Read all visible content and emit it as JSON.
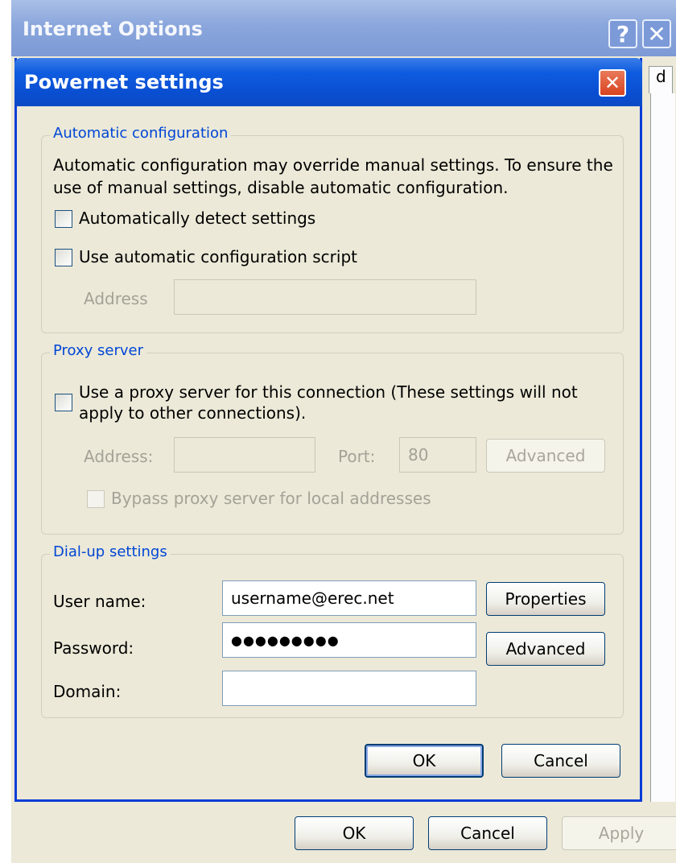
{
  "parent_window": {
    "title": "Internet Options",
    "help_glyph": "?",
    "close_glyph": "✕",
    "tab_sliver_text": "d",
    "buttons": {
      "ok": "OK",
      "cancel": "Cancel",
      "apply": "Apply"
    }
  },
  "dialog": {
    "title": "Powernet settings",
    "close_glyph": "✕",
    "automatic_configuration": {
      "legend": "Automatic configuration",
      "description_line1": "Automatic configuration may override manual settings.  To ensure the",
      "description_line2": "use of manual settings, disable automatic configuration.",
      "detect_label": "Automatically detect settings",
      "detect_checked": false,
      "script_label": "Use automatic configuration script",
      "script_checked": false,
      "address_label": "Address",
      "address_value": ""
    },
    "proxy_server": {
      "legend": "Proxy server",
      "use_proxy_line1": "Use a proxy server for this connection (These settings will not",
      "use_proxy_line2": "apply to other connections).",
      "use_proxy_checked": false,
      "address_label": "Address:",
      "address_value": "",
      "port_label": "Port:",
      "port_value": "80",
      "advanced_label": "Advanced",
      "bypass_label": "Bypass proxy server for local addresses",
      "bypass_checked": false
    },
    "dialup_settings": {
      "legend": "Dial-up settings",
      "username_label": "User name:",
      "username_value": "username@erec.net",
      "password_label": "Password:",
      "password_value": "●●●●●●●●●",
      "domain_label": "Domain:",
      "domain_value": "",
      "properties_label": "Properties",
      "advanced_label": "Advanced"
    },
    "buttons": {
      "ok": "OK",
      "cancel": "Cancel"
    }
  }
}
